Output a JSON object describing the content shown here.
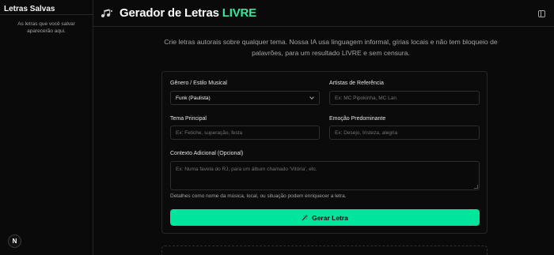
{
  "sidebar": {
    "title": "Letras Salvas",
    "empty_message": "As letras que você salvar aparecerão aqui.",
    "avatar_letter": "N"
  },
  "header": {
    "title_main": "Gerador de Letras",
    "title_accent": "LIVRE"
  },
  "intro": "Crie letras autorais sobre qualquer tema. Nossa IA usa linguagem informal, gírias locais e não tem bloqueio de palavrões, para um resultado LIVRE e sem censura.",
  "form": {
    "genre": {
      "label": "Gênero / Estilo Musical",
      "value": "Funk (Paulista)"
    },
    "artists": {
      "label": "Artistas de Referência",
      "placeholder": "Ex: MC Pipokinha, MC Lan"
    },
    "theme": {
      "label": "Tema Principal",
      "placeholder": "Ex: Fetiche, superação, festa"
    },
    "emotion": {
      "label": "Emoção Predominante",
      "placeholder": "Ex: Desejo, tristeza, alegria"
    },
    "context": {
      "label": "Contexto Adicional (Opcional)",
      "placeholder": "Ex: Numa favela do RJ, para um álbum chamado 'Vitória', etc."
    },
    "helper": "Detalhes como nome da música, local, ou situação podem enriquecer a letra.",
    "submit_label": "Gerar Letra"
  },
  "colors": {
    "accent": "#00e59e",
    "title_accent": "#34e89e",
    "background": "#0a0a0a"
  },
  "icons": {
    "logo": "music-notes-icon",
    "sidebar_toggle": "sidebar-toggle-icon",
    "submit": "magic-wand-icon"
  }
}
